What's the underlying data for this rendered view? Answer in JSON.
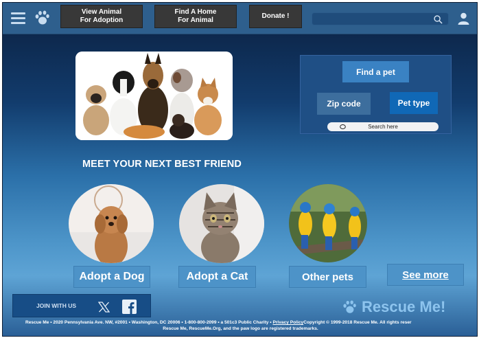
{
  "header": {
    "nav": [
      {
        "line1": "View Animal",
        "line2": "For Adoption"
      },
      {
        "line1": "Find A Home",
        "line2": "For Animal"
      },
      {
        "line1": "Donate !",
        "line2": ""
      }
    ],
    "search": {
      "placeholder": "",
      "value": ""
    }
  },
  "hero": {
    "image": "group-of-dogs-photo",
    "find_panel": {
      "find_label": "Find a pet",
      "zip_label": "Zip code",
      "type_label": "Pet type",
      "search_label": "Search here"
    }
  },
  "headline": "MEET YOUR NEXT BEST FRIEND",
  "pets": [
    {
      "image": "dog-photo",
      "button": "Adopt a Dog"
    },
    {
      "image": "cat-photo",
      "button": "Adopt a Cat"
    },
    {
      "image": "parrots-photo",
      "button": "Other pets"
    }
  ],
  "see_more": "See more",
  "footer": {
    "join_label": "JOIN WITH US",
    "brand": "Rescue Me!",
    "legal_line1_a": "Rescue Me • 2020 Pennsylvania Ave. NW, #2001 • Washington, DC 20006 • 1-800-800-2099 • a 501c3 Public Charity • ",
    "privacy_link": "Privacy Policy",
    "legal_line1_b": "Copyright © 1999-2018 Rescue Me. All rights reser",
    "legal_line2": "Rescue Me, RescueMe.Org, and the paw logo are registered trademarks."
  },
  "colors": {
    "header_bg": "#2e5f8d",
    "nav_button_bg": "#383838",
    "accent_blue": "#4d93c8",
    "brand_text": "#8dc4ee"
  },
  "icons": [
    "hamburger-menu-icon",
    "paw-icon",
    "search-icon",
    "user-icon",
    "x-twitter-icon",
    "facebook-icon"
  ]
}
